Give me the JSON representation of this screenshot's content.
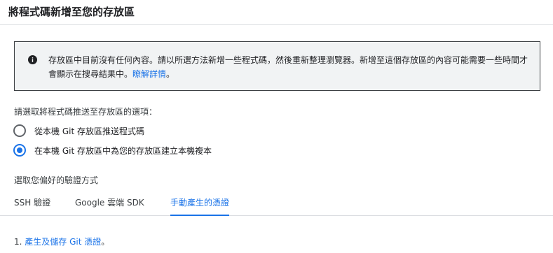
{
  "header": {
    "title": "將程式碼新增至您的存放區"
  },
  "info": {
    "icon": "info-icon",
    "text": "存放區中目前沒有任何內容。請以所選方法新增一些程式碼，然後重新整理瀏覽器。新增至這個存放區的內容可能需要一些時間才會顯示在搜尋結果中。",
    "link": "瞭解詳情",
    "suffix": "。"
  },
  "push": {
    "prompt": "請選取將程式碼推送至存放區的選項：",
    "options": [
      {
        "label": "從本機 Git 存放區推送程式碼",
        "checked": false
      },
      {
        "label": "在本機 Git 存放區中為您的存放區建立本機複本",
        "checked": true
      }
    ]
  },
  "auth": {
    "label": "選取您偏好的驗證方式",
    "tabs": [
      {
        "label": "SSH 驗證",
        "active": false
      },
      {
        "label": "Google 雲端 SDK",
        "active": false
      },
      {
        "label": "手動產生的憑證",
        "active": true
      }
    ]
  },
  "steps": [
    {
      "number": "1.",
      "link": "產生及儲存 Git 憑證",
      "suffix": "。"
    }
  ],
  "colors": {
    "accent": "#1a73e8",
    "info_bg": "#f1f3f4",
    "border": "#dadce0"
  }
}
